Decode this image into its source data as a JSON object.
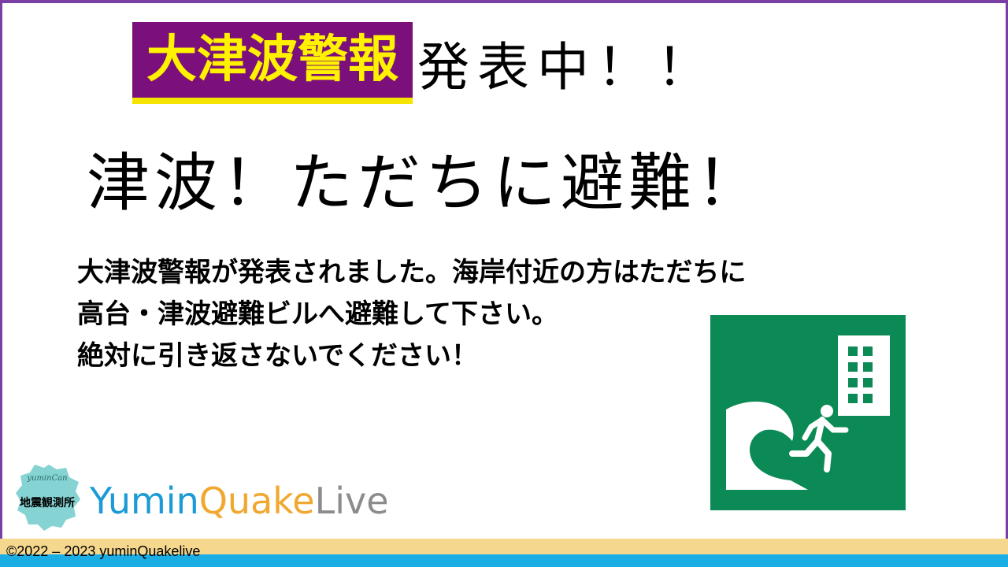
{
  "headline": {
    "badge_text": "大津波警報",
    "rest_text": "発表中！！"
  },
  "subhead": "津波！ただちに避難！",
  "message": {
    "lines": [
      "大津波警報が発表されました。海岸付近の方はただちに",
      "高台・津波避難ビルへ避難して下さい。",
      "絶対に引き返さないでください！"
    ]
  },
  "sign": {
    "icon": "tsunami-evacuation-building-icon",
    "background_color": "#0c8a55"
  },
  "logo": {
    "badge_script": "yuminCan",
    "badge_text": "地震観測所",
    "wordmark_part1": "Yumin",
    "wordmark_part2": "Quake",
    "wordmark_part3": "Live"
  },
  "footer": {
    "copyright": "©2022 – 2023 yuminQuakelive"
  },
  "colors": {
    "frame": "#7a3fa2",
    "badge_bg": "#7b0f7b",
    "badge_text": "#fff200",
    "sign_green": "#0c8a55",
    "footer_yellow": "#f5d78e",
    "footer_blue": "#1aaee5"
  }
}
